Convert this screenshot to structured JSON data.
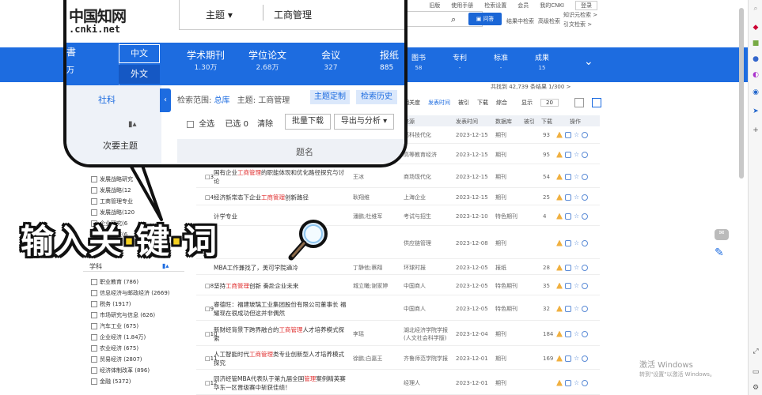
{
  "topbar": {
    "links": [
      "旧版",
      "使用手册",
      "检索设置",
      "会员",
      "我的CNKI"
    ],
    "login": "登录"
  },
  "header": {
    "search_button": "问答",
    "links": [
      "结果中检索",
      "高级检索",
      "知识元检索 >",
      "引文检索 >"
    ]
  },
  "nav": {
    "categories": [
      {
        "label": "图书",
        "num": "58"
      },
      {
        "label": "专利",
        "num": "-"
      },
      {
        "label": "标准",
        "num": "-"
      },
      {
        "label": "成果",
        "num": "15"
      }
    ]
  },
  "results": {
    "meta": "共找到 42,739 条结果   1/300  >",
    "sort": [
      "相关度",
      "发表时间",
      "被引",
      "下载",
      "综合"
    ],
    "show_label": "显示",
    "page_size": "20"
  },
  "table": {
    "headers": [
      "来源",
      "发表时间",
      "数据库",
      "被引",
      "下载",
      "操作"
    ],
    "rows": [
      {
        "idx": "",
        "title": "",
        "kw": "",
        "title_post": "",
        "author": "",
        "source": "高科技代化",
        "date": "2023-12-15",
        "db": "期刊",
        "cite": "",
        "dl": "93"
      },
      {
        "idx": "",
        "title": "",
        "kw": "",
        "title_post": "",
        "author": "",
        "source": "高等教育经济",
        "date": "2023-12-15",
        "db": "期刊",
        "cite": "",
        "dl": "95"
      },
      {
        "idx": "□3",
        "title": "国有企业",
        "kw": "工商管理",
        "title_post": "的职能体现和优化路径探究与讨论",
        "author": "王冰",
        "source": "商场现代化",
        "date": "2023-12-15",
        "db": "期刊",
        "cite": "",
        "dl": "54"
      },
      {
        "idx": "□4",
        "title": "经济新常态下企业",
        "kw": "工商管理",
        "title_post": "创新路径",
        "author": "耿翔维",
        "source": "上海企业",
        "date": "2023-12-15",
        "db": "期刊",
        "cite": "",
        "dl": "25"
      },
      {
        "idx": "",
        "title": "",
        "kw": "",
        "title_post": "计学专业",
        "author": "潘鹏;杜维军",
        "source": "考试与招生",
        "date": "2023-12-10",
        "db": "特色期刊",
        "cite": "",
        "dl": "4"
      },
      {
        "idx": "",
        "title": "",
        "kw": "",
        "title_post": "",
        "author": "",
        "source": "供应链管理",
        "date": "2023-12-08",
        "db": "期刊",
        "cite": "",
        "dl": ""
      },
      {
        "idx": "",
        "title": "MBA工作兼找了，美可学院通冷",
        "kw": "",
        "title_post": "",
        "author": "丁静他;蔡翔",
        "source": "环球时报",
        "date": "2023-12-05",
        "db": "报纸",
        "cite": "",
        "dl": "28"
      },
      {
        "idx": "□8",
        "title": "坚持",
        "kw": "工商管理",
        "title_post": "创新 奏赴企业未来",
        "author": "城立曦;谢家婷",
        "source": "中国商人",
        "date": "2023-12-05",
        "db": "特色期刊",
        "cite": "",
        "dl": "35"
      },
      {
        "idx": "□9",
        "title": "睿德旺：福建玻璃工业集团股份有限公司董事长 福耀现在很成功但这并非偶然",
        "kw": "",
        "title_post": "",
        "author": "",
        "source": "中国商人",
        "date": "2023-12-05",
        "db": "特色期刊",
        "cite": "",
        "dl": "32"
      },
      {
        "idx": "□10",
        "title": "新财经背景下跨界融合的",
        "kw": "工商管理",
        "title_post": "人才培养模式探索",
        "author": "李瑶",
        "source": "湖北经济学院学报(人文社会科学版)",
        "date": "2023-12-04",
        "db": "期刊",
        "cite": "",
        "dl": "184"
      },
      {
        "idx": "□11",
        "title": "人工智能时代",
        "kw": "工商管理",
        "title_post": "类专业创新型人才培养模式探究",
        "author": "徐鹏;白嘉王",
        "source": "齐鲁师范学院学报",
        "date": "2023-12-01",
        "db": "期刊",
        "cite": "",
        "dl": "169"
      },
      {
        "idx": "□12",
        "title": "同济经管MBA代表队于第九届全国",
        "kw": "管理",
        "title_post": "案例精英赛华东一区晋级赛中斩获佳绩！",
        "author": "",
        "source": "经理人",
        "date": "2023-12-01",
        "db": "期刊",
        "cite": "",
        "dl": ""
      }
    ]
  },
  "filters": {
    "upper": [
      "发展战略研究",
      "发展战略(12",
      "工商管理专业",
      "发展战略(120",
      "企业研究(6",
      "绩效考核(6"
    ],
    "subject_label": "学科",
    "subjects": [
      "职业教育 (786)",
      "信息经济与邮政经济 (2669)",
      "税务 (1917)",
      "市场研究与信息 (626)",
      "汽车工业 (675)",
      "企业经济 (1.84万)",
      "农业经济 (675)",
      "贸易经济 (2807)",
      "经济体制改革 (896)",
      "金融 (5372)"
    ]
  },
  "watermark": {
    "title": "激活 Windows",
    "sub": "转到\"设置\"以激活 Windows。"
  },
  "bubble": {
    "logo": "中国知网",
    "url": ".cnki.net",
    "topic": "主题 ▾",
    "query": "工商管理",
    "lang_cn": "中文",
    "lang_en": "外文",
    "left_cut": "書",
    "left_cut_num": "万",
    "categories": [
      {
        "label": "学术期刊",
        "num": "1.30万"
      },
      {
        "label": "学位论文",
        "num": "2.68万"
      },
      {
        "label": "会议",
        "num": "327"
      }
    ],
    "newspaper": {
      "label": "报纸",
      "num": "885"
    },
    "side_label": "社科",
    "secondary": "次要主题",
    "scope_label": "检索范围:",
    "scope_value": "总库",
    "scope_query": "主题: 工商管理",
    "btn_topic": "主题定制",
    "btn_hist": "检索历史",
    "select_all": "全选",
    "selected": "已选",
    "selected_count": "0",
    "clear": "清除",
    "batch_download": "批量下载",
    "export": "导出与分析 ▾",
    "col_title": "题名"
  },
  "caption": {
    "part1": "输入关",
    "dot1": "·",
    "part2": "键",
    "dot2": "·",
    "part3": "词"
  },
  "colors": {
    "brand_blue": "#1d6ce0",
    "keyword_red": "#e03030",
    "caption_yellow": "#f4d020"
  }
}
